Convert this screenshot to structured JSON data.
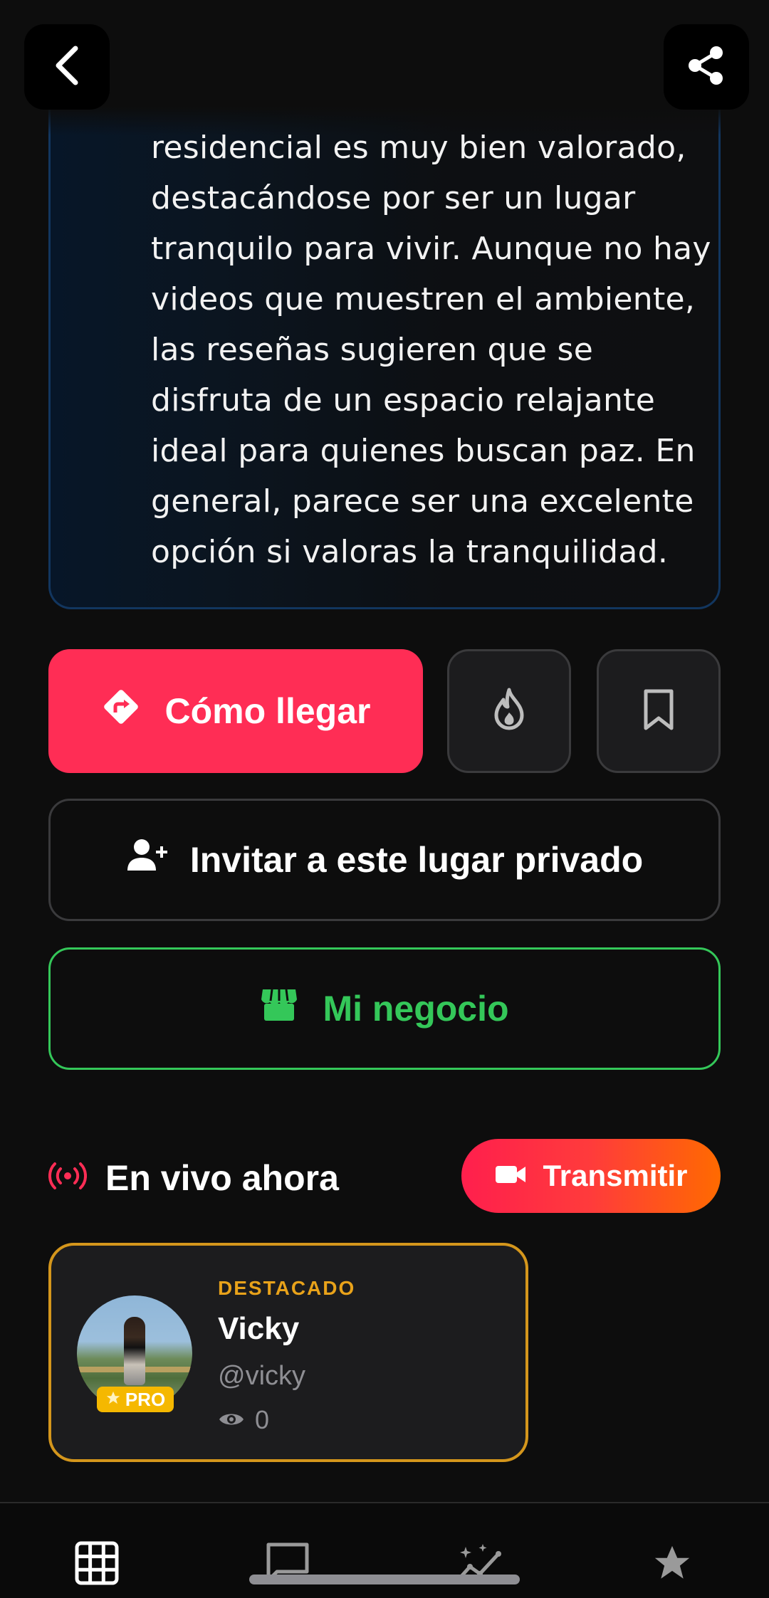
{
  "description": {
    "text": "residencial es muy bien valorado, destacándose por ser un lugar tranquilo para vivir. Aunque no hay videos que muestren el ambiente, las reseñas sugieren que se disfruta de un espacio relajante ideal para quienes buscan paz. En general, parece ser una excelente opción si valoras la tranquilidad."
  },
  "actions": {
    "directions_label": "Cómo llegar",
    "invite_label": "Invitar a este lugar privado",
    "business_label": "Mi negocio"
  },
  "live": {
    "title": "En vivo ahora",
    "stream_label": "Transmitir",
    "card": {
      "badge": "DESTACADO",
      "name": "Vicky",
      "handle": "@vicky",
      "views": "0",
      "pro_label": "PRO"
    }
  },
  "colors": {
    "primary": "#ff2d55",
    "business": "#34c759",
    "featured": "#e8a21a"
  },
  "icons": {
    "back": "chevron-left-icon",
    "share": "share-icon",
    "directions": "directions-icon",
    "fire": "fire-icon",
    "bookmark": "bookmark-icon",
    "invite": "person-add-icon",
    "business": "store-icon",
    "live": "broadcast-icon",
    "stream": "video-camera-icon",
    "nav": [
      "grid-icon",
      "chat-icon",
      "trending-icon",
      "star-icon"
    ]
  }
}
